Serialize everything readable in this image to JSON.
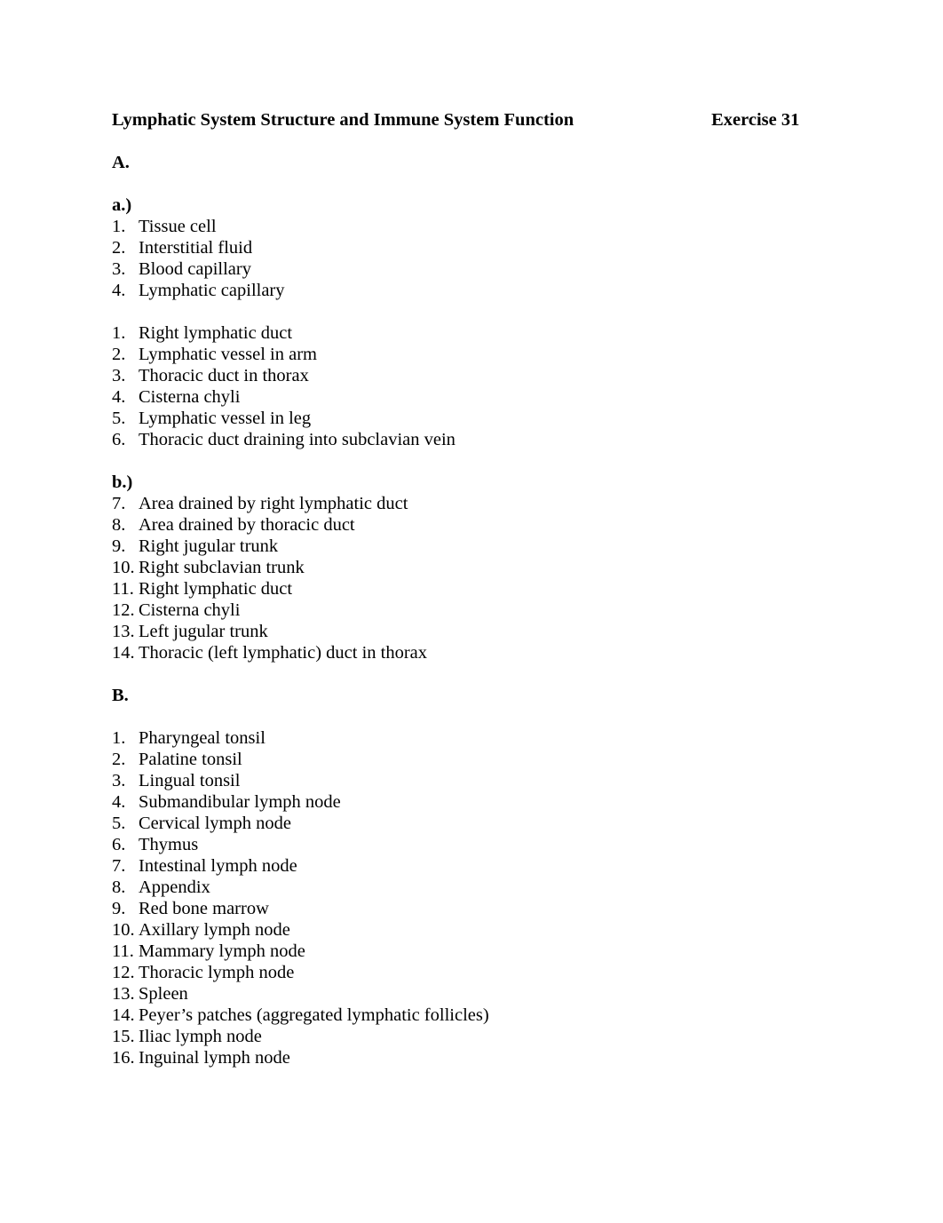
{
  "document": {
    "title": "Lymphatic System Structure and Immune System Function",
    "exercise_label": "Exercise 31"
  },
  "sections": [
    {
      "heading": "A.",
      "subsections": [
        {
          "heading": "a.)",
          "lists": [
            {
              "items": [
                {
                  "number": "1.",
                  "text": "Tissue cell"
                },
                {
                  "number": "2.",
                  "text": "Interstitial fluid"
                },
                {
                  "number": "3.",
                  "text": "Blood capillary"
                },
                {
                  "number": "4.",
                  "text": "Lymphatic capillary"
                }
              ]
            },
            {
              "items": [
                {
                  "number": "1.",
                  "text": "Right lymphatic duct"
                },
                {
                  "number": "2.",
                  "text": "Lymphatic vessel in arm"
                },
                {
                  "number": "3.",
                  "text": "Thoracic duct in thorax"
                },
                {
                  "number": "4.",
                  "text": "Cisterna chyli"
                },
                {
                  "number": "5.",
                  "text": "Lymphatic vessel in leg"
                },
                {
                  "number": "6.",
                  "text": " Thoracic duct draining into subclavian vein"
                }
              ]
            }
          ]
        },
        {
          "heading": "b.)",
          "lists": [
            {
              "items": [
                {
                  "number": "7.",
                  "text": "Area drained by right lymphatic duct"
                },
                {
                  "number": "8.",
                  "text": "Area drained by thoracic duct"
                },
                {
                  "number": "9.",
                  "text": "Right jugular trunk"
                },
                {
                  "number": "10.",
                  "text": "Right subclavian trunk"
                },
                {
                  "number": "11.",
                  "text": "Right lymphatic duct"
                },
                {
                  "number": "12.",
                  "text": "Cisterna chyli"
                },
                {
                  "number": "13.",
                  "text": "Left jugular trunk"
                },
                {
                  "number": "14.",
                  "text": "Thoracic (left lymphatic) duct in thorax"
                }
              ]
            }
          ]
        }
      ]
    },
    {
      "heading": "B.",
      "subsections": [
        {
          "heading": "",
          "lists": [
            {
              "items": [
                {
                  "number": "1.",
                  "text": "Pharyngeal tonsil"
                },
                {
                  "number": "2.",
                  "text": "Palatine tonsil"
                },
                {
                  "number": "3.",
                  "text": "Lingual tonsil"
                },
                {
                  "number": "4.",
                  "text": "Submandibular lymph node"
                },
                {
                  "number": "5.",
                  "text": "Cervical lymph node"
                },
                {
                  "number": "6.",
                  "text": "Thymus"
                },
                {
                  "number": "7.",
                  "text": "Intestinal lymph node"
                },
                {
                  "number": "8.",
                  "text": "Appendix"
                },
                {
                  "number": "9.",
                  "text": "Red bone marrow"
                },
                {
                  "number": "10.",
                  "text": "Axillary lymph node"
                },
                {
                  "number": "11.",
                  "text": "Mammary lymph node"
                },
                {
                  "number": "12.",
                  "text": "Thoracic lymph node"
                },
                {
                  "number": "13.",
                  "text": "Spleen"
                },
                {
                  "number": "14.",
                  "text": "Peyer’s patches (aggregated lymphatic follicles)"
                },
                {
                  "number": "15.",
                  "text": "Iliac lymph node"
                },
                {
                  "number": "16.",
                  "text": "Inguinal lymph node"
                }
              ]
            }
          ]
        }
      ]
    }
  ],
  "colors": {
    "page_background": "#ffffff",
    "text": "#000000"
  }
}
